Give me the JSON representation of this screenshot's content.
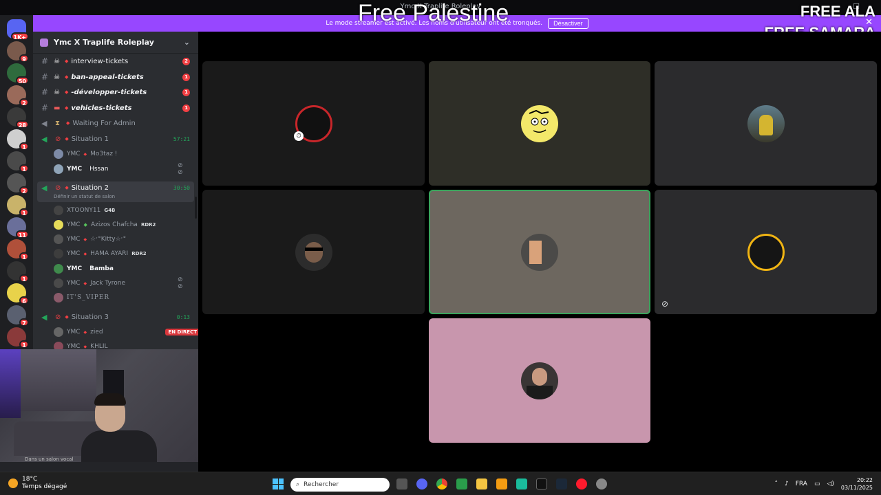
{
  "window": {
    "title": "Ymc X Traplife Roleplay",
    "minimize": "—",
    "maximize": "☐",
    "close": "✕"
  },
  "stream_overlay": {
    "center_text": "Free Palestine",
    "right_line1": "FREE ALA",
    "right_line2": "FREE SAMARA"
  },
  "streamer_banner": {
    "message": "Le mode streamer est activé. Les noms d'utilisateur ont été tronqués.",
    "button": "Désactiver",
    "close": "✕"
  },
  "server_rail": {
    "items": [
      {
        "badge": "1K+"
      },
      {
        "badge": "9"
      },
      {
        "badge": "50"
      },
      {
        "badge": "2"
      },
      {
        "badge": "28"
      },
      {
        "badge": "1"
      },
      {
        "badge": "1"
      },
      {
        "badge": "2"
      },
      {
        "badge": "1"
      },
      {
        "badge": "11"
      },
      {
        "badge": "1"
      },
      {
        "badge": "1"
      },
      {
        "badge": "6"
      },
      {
        "badge": "7"
      },
      {
        "badge": "1"
      }
    ]
  },
  "server": {
    "name": "Ymc X Traplife Roleplay",
    "channels": [
      {
        "name": "interview-tickets",
        "count": "2"
      },
      {
        "name": "ban-appeal-tickets",
        "count": "1"
      },
      {
        "name": "-développer-tickets",
        "count": "1"
      },
      {
        "name": "vehicles-tickets",
        "count": "1"
      }
    ],
    "voice": {
      "waiting": "Waiting For Admin",
      "situation1": {
        "name": "Situation 1",
        "timer": "57:21"
      },
      "situation2": {
        "name": "Situation 2",
        "timer": "30:50",
        "status": "Définir un statut de salon"
      },
      "situation3": {
        "name": "Situation 3",
        "timer": "0:13"
      }
    },
    "s1_users": [
      {
        "tag": "YMC",
        "name": "Mo3taz !"
      },
      {
        "tag": "YMC",
        "name": "Hssan"
      }
    ],
    "s2_users": [
      {
        "tag": "",
        "name": "XTOONY11",
        "badge": "G4B"
      },
      {
        "tag": "YMC",
        "name": "Azizos Chafcha",
        "badge": "RDR2"
      },
      {
        "tag": "YMC",
        "name": "☆ˑ°Kitty☆ˑ°",
        "badge": ""
      },
      {
        "tag": "YMC",
        "name": "HAMA AYARI",
        "badge": "RDR2"
      },
      {
        "tag": "YMC",
        "name": "Bamba",
        "badge": ""
      },
      {
        "tag": "YMC",
        "name": "Jack Tyrone",
        "badge": ""
      },
      {
        "tag": "",
        "name": "IT'S_VIPER",
        "badge": ""
      }
    ],
    "s3_users": [
      {
        "tag": "YMC",
        "name": "zied",
        "live": "EN DIRECT"
      },
      {
        "tag": "YMC",
        "name": "KHLIL"
      }
    ]
  },
  "webcam": {
    "caption": "Dans un salon vocal"
  },
  "taskbar": {
    "temperature": "18°C",
    "weather": "Temps dégagé",
    "search_placeholder": "Rechercher",
    "language": "FRA",
    "time": "20:22",
    "date": "03/11/2025"
  },
  "colors": {
    "accent": "#9747ff",
    "speaking": "#3ba55d",
    "alert": "#f23f43"
  }
}
